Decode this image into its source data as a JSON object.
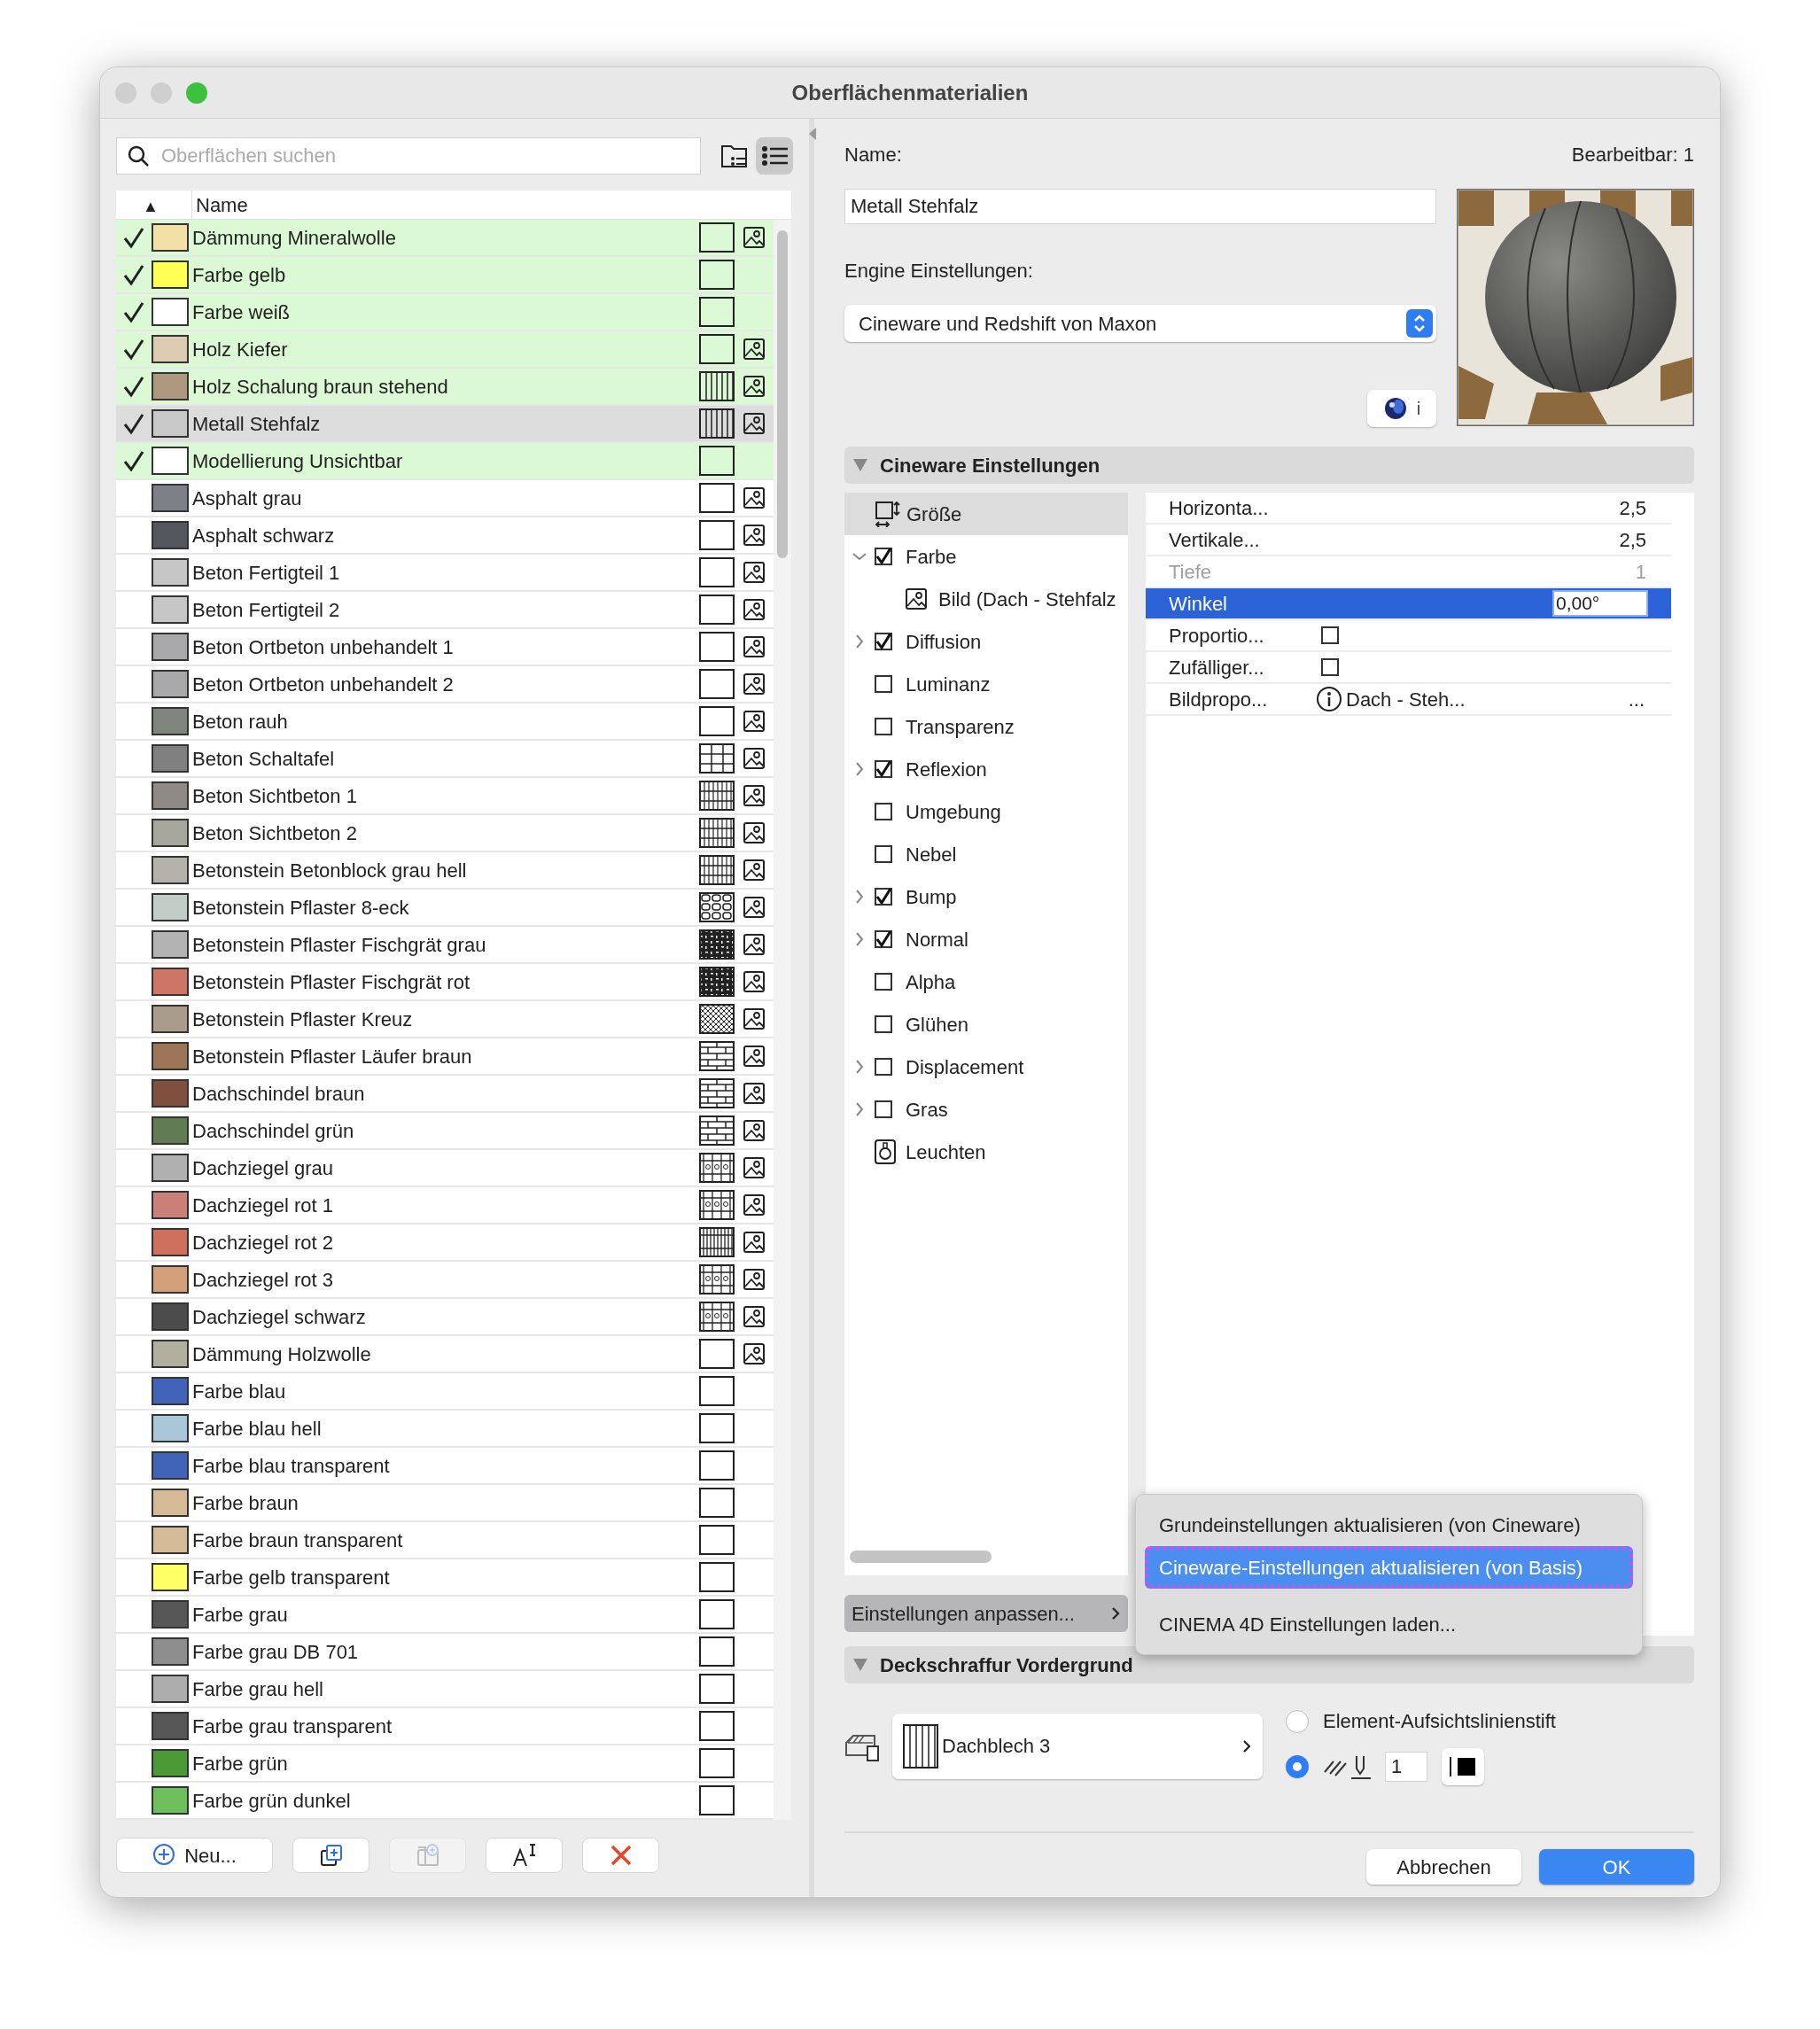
{
  "window": {
    "title": "Oberflächenmaterialien"
  },
  "search": {
    "placeholder": "Oberflächen suchen"
  },
  "view_buttons": [
    {
      "kind": "folders",
      "selected": false
    },
    {
      "kind": "list",
      "selected": true
    }
  ],
  "list": {
    "sort_indicator": "▲",
    "header": "Name"
  },
  "materials": [
    {
      "name": "Dämmung Mineralwolle",
      "color": "#f3e0a6",
      "kind": "empty",
      "preview": true,
      "used": true,
      "selected": false
    },
    {
      "name": "Farbe gelb",
      "color": "#ffff55",
      "kind": "empty",
      "preview": false,
      "used": true,
      "selected": false
    },
    {
      "name": "Farbe weiß",
      "color": "#ffffff",
      "kind": "empty",
      "preview": false,
      "used": true,
      "selected": false
    },
    {
      "name": "Holz Kiefer",
      "color": "#dccbb0",
      "kind": "empty",
      "preview": true,
      "used": true,
      "selected": false
    },
    {
      "name": "Holz Schalung braun stehend",
      "color": "#ae9880",
      "kind": "vertical",
      "preview": true,
      "used": true,
      "selected": false
    },
    {
      "name": "Metall Stehfalz",
      "color": "#c8c8c8",
      "kind": "vertical",
      "preview": true,
      "used": true,
      "selected": true
    },
    {
      "name": "Modellierung Unsichtbar",
      "color": "#ffffff",
      "kind": "empty",
      "preview": false,
      "used": true,
      "selected": false
    },
    {
      "name": "Asphalt grau",
      "color": "#7d8086",
      "kind": "empty",
      "preview": true,
      "used": false,
      "selected": false
    },
    {
      "name": "Asphalt schwarz",
      "color": "#55575e",
      "kind": "empty",
      "preview": true,
      "used": false,
      "selected": false
    },
    {
      "name": "Beton Fertigteil 1",
      "color": "#c6c6c6",
      "kind": "empty",
      "preview": true,
      "used": false,
      "selected": false
    },
    {
      "name": "Beton Fertigteil 2",
      "color": "#c6c6c6",
      "kind": "empty",
      "preview": true,
      "used": false,
      "selected": false
    },
    {
      "name": "Beton Ortbeton unbehandelt 1",
      "color": "#a9a9ab",
      "kind": "empty",
      "preview": true,
      "used": false,
      "selected": false
    },
    {
      "name": "Beton Ortbeton unbehandelt 2",
      "color": "#a9a9ab",
      "kind": "empty",
      "preview": true,
      "used": false,
      "selected": false
    },
    {
      "name": "Beton rauh",
      "color": "#7d857c",
      "kind": "empty",
      "preview": true,
      "used": false,
      "selected": false
    },
    {
      "name": "Beton Schaltafel",
      "color": "#808080",
      "kind": "grid",
      "preview": true,
      "used": false,
      "selected": false
    },
    {
      "name": "Beton Sichtbeton 1",
      "color": "#8f8a86",
      "kind": "densegrid",
      "preview": true,
      "used": false,
      "selected": false
    },
    {
      "name": "Beton Sichtbeton 2",
      "color": "#a7a69c",
      "kind": "densegrid",
      "preview": true,
      "used": false,
      "selected": false
    },
    {
      "name": "Betonstein Betonblock grau hell",
      "color": "#b5b2ab",
      "kind": "densegrid",
      "preview": true,
      "used": false,
      "selected": false
    },
    {
      "name": "Betonstein Pflaster 8-eck",
      "color": "#c2cdc5",
      "kind": "octagon",
      "preview": true,
      "used": false,
      "selected": false
    },
    {
      "name": "Betonstein Pflaster Fischgrät grau",
      "color": "#b3b3b3",
      "kind": "herringbone",
      "preview": true,
      "used": false,
      "selected": false
    },
    {
      "name": "Betonstein Pflaster Fischgrät rot",
      "color": "#cf7565",
      "kind": "herringbone",
      "preview": true,
      "used": false,
      "selected": false
    },
    {
      "name": "Betonstein Pflaster Kreuz",
      "color": "#a99c8b",
      "kind": "cross",
      "preview": true,
      "used": false,
      "selected": false
    },
    {
      "name": "Betonstein Pflaster Läufer braun",
      "color": "#9c7458",
      "kind": "brick",
      "preview": true,
      "used": false,
      "selected": false
    },
    {
      "name": "Dachschindel braun",
      "color": "#814f3d",
      "kind": "brick",
      "preview": true,
      "used": false,
      "selected": false
    },
    {
      "name": "Dachschindel grün",
      "color": "#607a54",
      "kind": "brick",
      "preview": true,
      "used": false,
      "selected": false
    },
    {
      "name": "Dachziegel grau",
      "color": "#b0b0b0",
      "kind": "tile",
      "preview": true,
      "used": false,
      "selected": false
    },
    {
      "name": "Dachziegel rot 1",
      "color": "#c98078",
      "kind": "tile",
      "preview": true,
      "used": false,
      "selected": false
    },
    {
      "name": "Dachziegel rot 2",
      "color": "#cf705e",
      "kind": "densetile",
      "preview": true,
      "used": false,
      "selected": false
    },
    {
      "name": "Dachziegel rot 3",
      "color": "#d29f7a",
      "kind": "tile",
      "preview": true,
      "used": false,
      "selected": false
    },
    {
      "name": "Dachziegel schwarz",
      "color": "#4c4c4c",
      "kind": "tile",
      "preview": true,
      "used": false,
      "selected": false
    },
    {
      "name": "Dämmung Holzwolle",
      "color": "#b1b09e",
      "kind": "empty",
      "preview": true,
      "used": false,
      "selected": false
    },
    {
      "name": "Farbe blau",
      "color": "#4264b8",
      "kind": "empty",
      "preview": false,
      "used": false,
      "selected": false
    },
    {
      "name": "Farbe blau hell",
      "color": "#aac6d9",
      "kind": "empty",
      "preview": false,
      "used": false,
      "selected": false
    },
    {
      "name": "Farbe blau transparent",
      "color": "#4264b8",
      "kind": "empty",
      "preview": false,
      "used": false,
      "selected": false
    },
    {
      "name": "Farbe braun",
      "color": "#d6bb98",
      "kind": "empty",
      "preview": false,
      "used": false,
      "selected": false
    },
    {
      "name": "Farbe braun transparent",
      "color": "#d6bb98",
      "kind": "empty",
      "preview": false,
      "used": false,
      "selected": false
    },
    {
      "name": "Farbe gelb transparent",
      "color": "#ffff66",
      "kind": "empty",
      "preview": false,
      "used": false,
      "selected": false
    },
    {
      "name": "Farbe grau",
      "color": "#575757",
      "kind": "empty",
      "preview": false,
      "used": false,
      "selected": false
    },
    {
      "name": "Farbe grau DB 701",
      "color": "#8e8e8e",
      "kind": "empty",
      "preview": false,
      "used": false,
      "selected": false
    },
    {
      "name": "Farbe grau hell",
      "color": "#adadad",
      "kind": "empty",
      "preview": false,
      "used": false,
      "selected": false
    },
    {
      "name": "Farbe grau transparent",
      "color": "#575757",
      "kind": "empty",
      "preview": false,
      "used": false,
      "selected": false
    },
    {
      "name": "Farbe grün",
      "color": "#4c9a35",
      "kind": "empty",
      "preview": false,
      "used": false,
      "selected": false
    },
    {
      "name": "Farbe grün dunkel",
      "color": "#6ebe5c",
      "kind": "empty",
      "preview": false,
      "used": false,
      "selected": false
    }
  ],
  "actions": [
    {
      "kind": "new",
      "label": "Neu...",
      "disabled": false
    },
    {
      "kind": "duplicate",
      "disabled": false
    },
    {
      "kind": "new-folder",
      "disabled": true
    },
    {
      "kind": "rename",
      "disabled": false
    },
    {
      "kind": "delete",
      "disabled": false
    }
  ],
  "editor": {
    "name_label": "Name:",
    "editable": "Bearbeitbar: 1",
    "name_value": "Metall Stehfalz",
    "engine_label": "Engine Einstellungen:",
    "engine_value": "Cineware und Redshift von Maxon",
    "info_button": "i"
  },
  "cineware": {
    "title": "Cineware Einstellungen",
    "expanded": true,
    "channels": [
      {
        "kind": "size",
        "label": "Größe",
        "selected": true
      },
      {
        "kind": "checkbox",
        "label": "Farbe",
        "checked": true,
        "expanded": true,
        "selected": false,
        "children": [
          {
            "kind": "image",
            "label": "Bild (Dach - Stehfalz",
            "selected": false
          }
        ]
      },
      {
        "kind": "checkbox",
        "label": "Diffusion",
        "checked": true,
        "expanded": false,
        "selected": false
      },
      {
        "kind": "checkbox",
        "label": "Luminanz",
        "checked": false,
        "selected": false
      },
      {
        "kind": "checkbox",
        "label": "Transparenz",
        "checked": false,
        "selected": false
      },
      {
        "kind": "checkbox",
        "label": "Reflexion",
        "checked": true,
        "expanded": false,
        "selected": false
      },
      {
        "kind": "checkbox",
        "label": "Umgebung",
        "checked": false,
        "selected": false
      },
      {
        "kind": "checkbox",
        "label": "Nebel",
        "checked": false,
        "selected": false
      },
      {
        "kind": "checkbox",
        "label": "Bump",
        "checked": true,
        "expanded": false,
        "selected": false
      },
      {
        "kind": "checkbox",
        "label": "Normal",
        "checked": true,
        "expanded": false,
        "selected": false
      },
      {
        "kind": "checkbox",
        "label": "Alpha",
        "checked": false,
        "selected": false
      },
      {
        "kind": "checkbox",
        "label": "Glühen",
        "checked": false,
        "selected": false
      },
      {
        "kind": "checkbox",
        "label": "Displacement",
        "checked": false,
        "expanded": false,
        "selected": false
      },
      {
        "kind": "checkbox",
        "label": "Gras",
        "checked": false,
        "expanded": false,
        "selected": false
      },
      {
        "kind": "light",
        "label": "Leuchten",
        "selected": false
      }
    ],
    "properties": [
      {
        "kind": "number",
        "label": "Horizonta...",
        "value": "2,5",
        "disabled": false,
        "selected": false
      },
      {
        "kind": "number",
        "label": "Vertikale...",
        "value": "2,5",
        "disabled": false,
        "selected": false
      },
      {
        "kind": "number",
        "label": "Tiefe",
        "value": "1",
        "disabled": true,
        "selected": false
      },
      {
        "kind": "edit",
        "label": "Winkel",
        "value": "0,00°",
        "disabled": false,
        "selected": true
      },
      {
        "kind": "checkbox",
        "label": "Proportio...",
        "checked": false,
        "disabled": false,
        "selected": false
      },
      {
        "kind": "checkbox",
        "label": "Zufälliger...",
        "checked": false,
        "disabled": false,
        "selected": false
      },
      {
        "kind": "file",
        "label": "Bildpropo...",
        "value": "Dach - Steh...",
        "more": "...",
        "disabled": false,
        "selected": false
      }
    ],
    "adjust_button": "Einstellungen anpassen...",
    "menu": [
      {
        "label": "Grundeinstellungen aktualisieren (von Cineware)",
        "selected": false,
        "outlined": false
      },
      {
        "label": "Cineware-Einstellungen aktualisieren (von Basis)",
        "selected": true,
        "outlined": true
      },
      {
        "label": "CINEMA 4D Einstellungen laden...",
        "selected": false,
        "outlined": false
      }
    ]
  },
  "hatch_section": {
    "title": "Deckschraffur Vordergrund",
    "expanded": true,
    "hatch": "Dachblech 3",
    "pen_options": [
      {
        "kind": "element",
        "label": "Element-Aufsichtslinienstift",
        "selected": false
      },
      {
        "kind": "custom",
        "pen": "1",
        "selected": true
      }
    ]
  },
  "buttons": [
    {
      "label": "Abbrechen",
      "primary": false
    },
    {
      "label": "OK",
      "primary": true
    }
  ]
}
